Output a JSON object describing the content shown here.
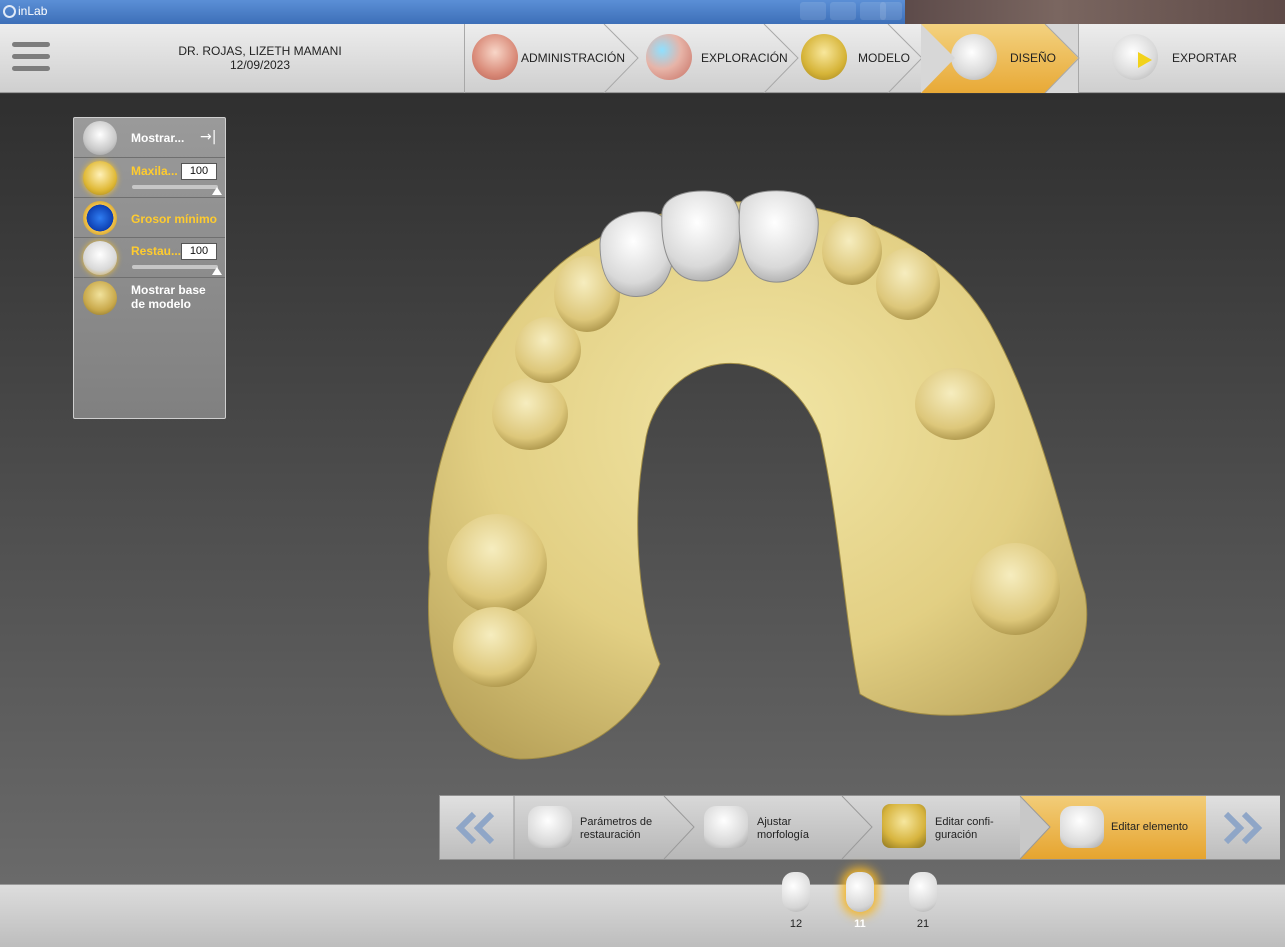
{
  "window": {
    "title": "inLab"
  },
  "patient": {
    "name": "DR. ROJAS, LIZETH MAMANI",
    "date": "12/09/2023"
  },
  "steps": [
    {
      "label": "ADMINISTRACIÓN",
      "icon": "jaw-model-icon",
      "active": false
    },
    {
      "label": "EXPLORACIÓN",
      "icon": "scan-jaw-icon",
      "active": false
    },
    {
      "label": "MODELO",
      "icon": "model-base-icon",
      "active": false
    },
    {
      "label": "DISEÑO",
      "icon": "crown-mesh-icon",
      "active": true
    },
    {
      "label": "EXPORTAR",
      "icon": "export-arrow-icon",
      "active": false
    }
  ],
  "panel": {
    "show_label": "Mostrar...",
    "rows": [
      {
        "label": "Maxila...",
        "value": "100",
        "slider_level": 1.0
      },
      {
        "label": "Grosor mínimo"
      },
      {
        "label": "Restau...",
        "value": "100",
        "slider_level": 1.0
      },
      {
        "label": "Mostrar base de modelo"
      }
    ]
  },
  "substeps": [
    {
      "label": "Parámetros de restauración",
      "active": false
    },
    {
      "label": "Ajustar morfología",
      "active": false
    },
    {
      "label": "Editar confi- guración",
      "active": false
    },
    {
      "label": "Editar elemento",
      "active": true
    }
  ],
  "teeth": [
    {
      "number": "12",
      "selected": false
    },
    {
      "number": "11",
      "selected": true
    },
    {
      "number": "21",
      "selected": false
    }
  ],
  "colors": {
    "accent": "#e8a936",
    "model": "#e6d487",
    "crown": "#e2e2e2"
  }
}
